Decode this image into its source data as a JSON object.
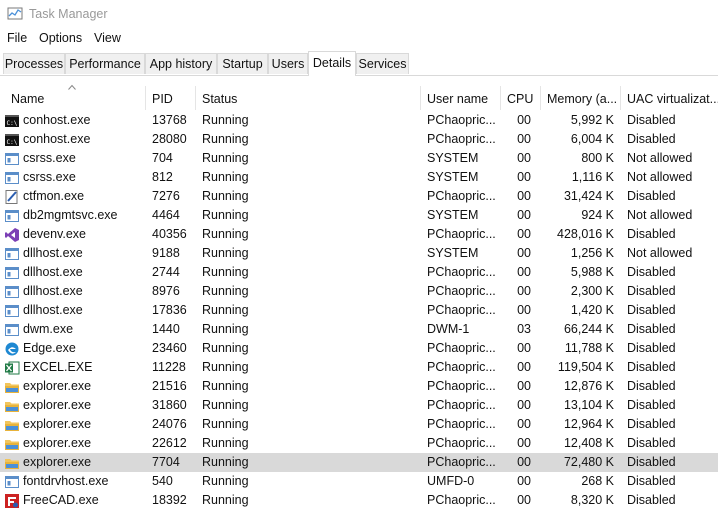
{
  "window": {
    "title": "Task Manager"
  },
  "menu": [
    "File",
    "Options",
    "View"
  ],
  "tabs": [
    {
      "label": "Processes",
      "active": false
    },
    {
      "label": "Performance",
      "active": false
    },
    {
      "label": "App history",
      "active": false
    },
    {
      "label": "Startup",
      "active": false
    },
    {
      "label": "Users",
      "active": false
    },
    {
      "label": "Details",
      "active": true
    },
    {
      "label": "Services",
      "active": false
    }
  ],
  "columns": [
    "Name",
    "PID",
    "Status",
    "User name",
    "CPU",
    "Memory (a...",
    "UAC virtualizat..."
  ],
  "colors": {
    "selected_row": "#d9d9d9",
    "accent": "#0078d7"
  },
  "rows": [
    {
      "icon": "console-icon",
      "name": "conhost.exe",
      "pid": "13768",
      "status": "Running",
      "user": "PChaopric...",
      "cpu": "00",
      "memory": "5,992 K",
      "uac": "Disabled"
    },
    {
      "icon": "console-icon",
      "name": "conhost.exe",
      "pid": "28080",
      "status": "Running",
      "user": "PChaopric...",
      "cpu": "00",
      "memory": "6,004 K",
      "uac": "Disabled"
    },
    {
      "icon": "process-icon",
      "name": "csrss.exe",
      "pid": "704",
      "status": "Running",
      "user": "SYSTEM",
      "cpu": "00",
      "memory": "800 K",
      "uac": "Not allowed"
    },
    {
      "icon": "process-icon",
      "name": "csrss.exe",
      "pid": "812",
      "status": "Running",
      "user": "SYSTEM",
      "cpu": "00",
      "memory": "1,116 K",
      "uac": "Not allowed"
    },
    {
      "icon": "pen-icon",
      "name": "ctfmon.exe",
      "pid": "7276",
      "status": "Running",
      "user": "PChaopric...",
      "cpu": "00",
      "memory": "31,424 K",
      "uac": "Disabled"
    },
    {
      "icon": "process-icon",
      "name": "db2mgmtsvc.exe",
      "pid": "4464",
      "status": "Running",
      "user": "SYSTEM",
      "cpu": "00",
      "memory": "924 K",
      "uac": "Not allowed"
    },
    {
      "icon": "visual-studio-icon",
      "name": "devenv.exe",
      "pid": "40356",
      "status": "Running",
      "user": "PChaopric...",
      "cpu": "00",
      "memory": "428,016 K",
      "uac": "Disabled"
    },
    {
      "icon": "process-icon",
      "name": "dllhost.exe",
      "pid": "9188",
      "status": "Running",
      "user": "SYSTEM",
      "cpu": "00",
      "memory": "1,256 K",
      "uac": "Not allowed"
    },
    {
      "icon": "process-icon",
      "name": "dllhost.exe",
      "pid": "2744",
      "status": "Running",
      "user": "PChaopric...",
      "cpu": "00",
      "memory": "5,988 K",
      "uac": "Disabled"
    },
    {
      "icon": "process-icon",
      "name": "dllhost.exe",
      "pid": "8976",
      "status": "Running",
      "user": "PChaopric...",
      "cpu": "00",
      "memory": "2,300 K",
      "uac": "Disabled"
    },
    {
      "icon": "process-icon",
      "name": "dllhost.exe",
      "pid": "17836",
      "status": "Running",
      "user": "PChaopric...",
      "cpu": "00",
      "memory": "1,420 K",
      "uac": "Disabled"
    },
    {
      "icon": "process-icon",
      "name": "dwm.exe",
      "pid": "1440",
      "status": "Running",
      "user": "DWM-1",
      "cpu": "03",
      "memory": "66,244 K",
      "uac": "Disabled"
    },
    {
      "icon": "edge-icon",
      "name": "Edge.exe",
      "pid": "23460",
      "status": "Running",
      "user": "PChaopric...",
      "cpu": "00",
      "memory": "11,788 K",
      "uac": "Disabled"
    },
    {
      "icon": "excel-icon",
      "name": "EXCEL.EXE",
      "pid": "11228",
      "status": "Running",
      "user": "PChaopric...",
      "cpu": "00",
      "memory": "119,504 K",
      "uac": "Disabled"
    },
    {
      "icon": "folder-icon",
      "name": "explorer.exe",
      "pid": "21516",
      "status": "Running",
      "user": "PChaopric...",
      "cpu": "00",
      "memory": "12,876 K",
      "uac": "Disabled"
    },
    {
      "icon": "folder-icon",
      "name": "explorer.exe",
      "pid": "31860",
      "status": "Running",
      "user": "PChaopric...",
      "cpu": "00",
      "memory": "13,104 K",
      "uac": "Disabled"
    },
    {
      "icon": "folder-icon",
      "name": "explorer.exe",
      "pid": "24076",
      "status": "Running",
      "user": "PChaopric...",
      "cpu": "00",
      "memory": "12,964 K",
      "uac": "Disabled"
    },
    {
      "icon": "folder-icon",
      "name": "explorer.exe",
      "pid": "22612",
      "status": "Running",
      "user": "PChaopric...",
      "cpu": "00",
      "memory": "12,408 K",
      "uac": "Disabled"
    },
    {
      "icon": "folder-icon",
      "name": "explorer.exe",
      "pid": "7704",
      "status": "Running",
      "user": "PChaopric...",
      "cpu": "00",
      "memory": "72,480 K",
      "uac": "Disabled",
      "selected": true
    },
    {
      "icon": "process-icon",
      "name": "fontdrvhost.exe",
      "pid": "540",
      "status": "Running",
      "user": "UMFD-0",
      "cpu": "00",
      "memory": "268 K",
      "uac": "Disabled"
    },
    {
      "icon": "freecad-icon",
      "name": "FreeCAD.exe",
      "pid": "18392",
      "status": "Running",
      "user": "PChaopric...",
      "cpu": "00",
      "memory": "8,320 K",
      "uac": "Disabled"
    }
  ]
}
